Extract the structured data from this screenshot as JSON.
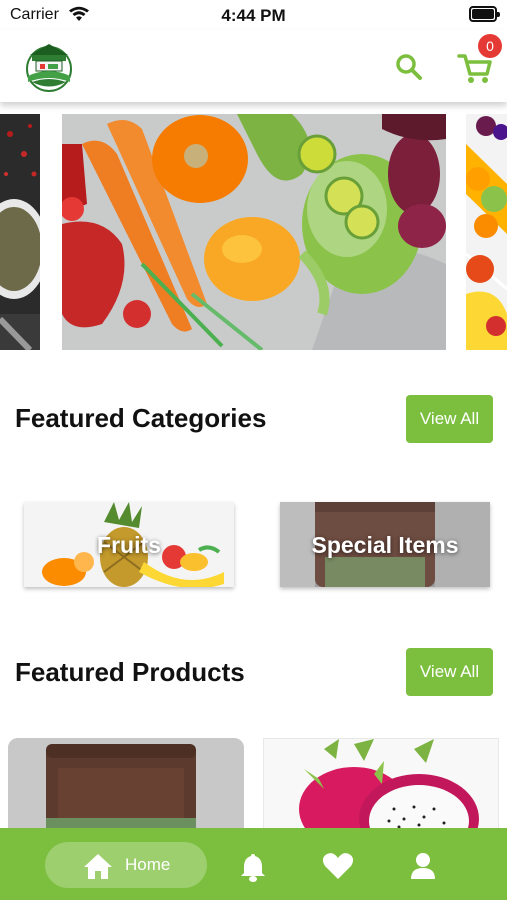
{
  "status_bar": {
    "carrier": "Carrier",
    "time": "4:44 PM"
  },
  "header": {
    "cart_count": "0",
    "search_icon": "search-icon",
    "cart_icon": "shopping-cart-icon",
    "accent_color": "#7cbf3f"
  },
  "featured_categories": {
    "title": "Featured Categories",
    "view_all": "View All",
    "items": [
      {
        "label": "Fruits"
      },
      {
        "label": "Special Items"
      }
    ]
  },
  "featured_products": {
    "title": "Featured Products",
    "view_all": "View All"
  },
  "bottom_nav": {
    "home_label": "Home",
    "items": [
      "home-icon",
      "bell-icon",
      "heart-icon",
      "profile-icon"
    ]
  },
  "colors": {
    "primary": "#7cbf3f",
    "badge": "#e53935"
  }
}
